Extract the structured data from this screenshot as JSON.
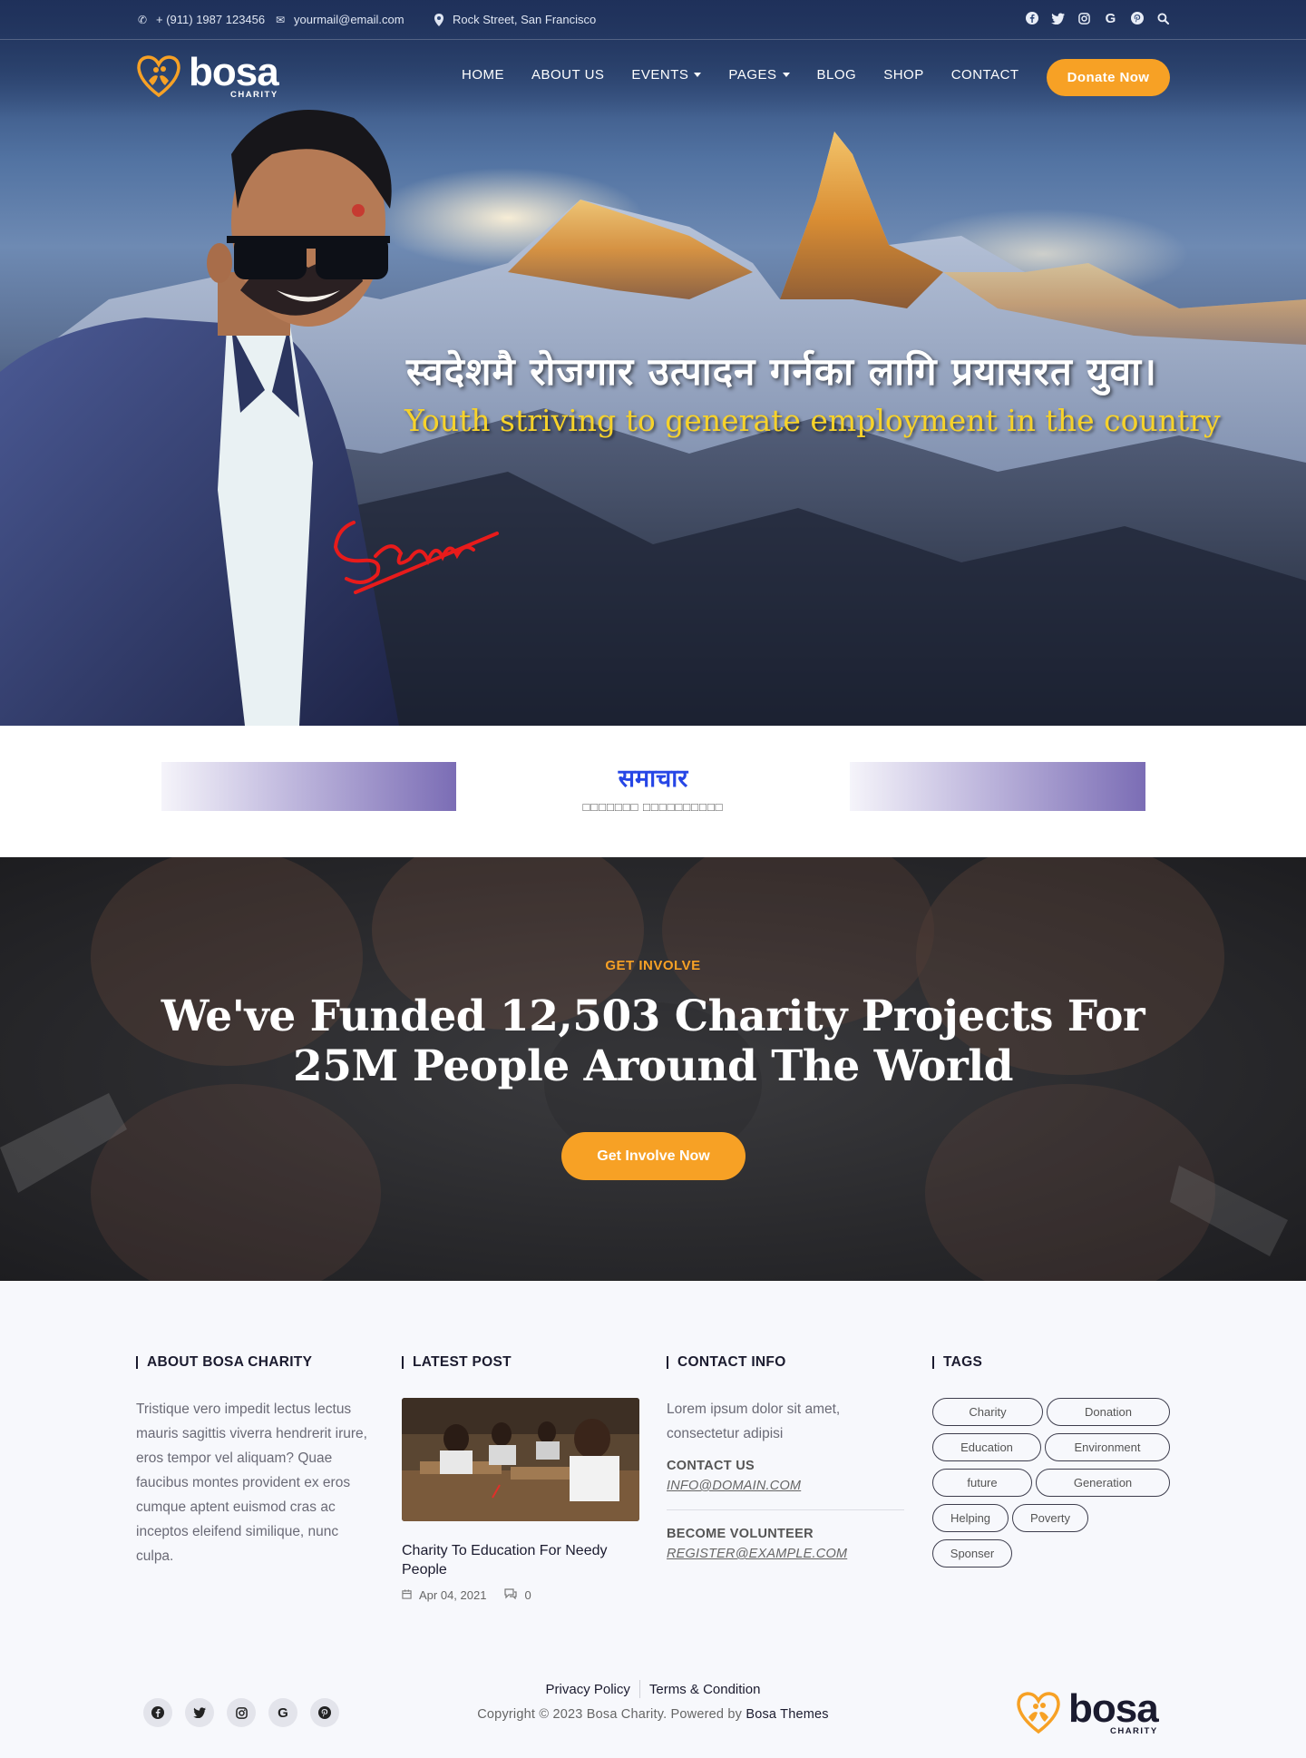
{
  "topbar": {
    "phone": "+ (911) 1987 123456",
    "email": "yourmail@email.com",
    "address": "Rock Street, San Francisco",
    "social_icons": [
      "facebook-icon",
      "twitter-icon",
      "instagram-icon",
      "google-icon",
      "pinterest-icon",
      "search-icon"
    ]
  },
  "brand": {
    "name": "bosa",
    "tagline": "CHARITY"
  },
  "nav": {
    "items": [
      {
        "label": "HOME"
      },
      {
        "label": "ABOUT US"
      },
      {
        "label": "EVENTS"
      },
      {
        "label": "PAGES"
      },
      {
        "label": "BLOG"
      },
      {
        "label": "SHOP"
      },
      {
        "label": "CONTACT"
      }
    ],
    "donate_label": "Donate Now"
  },
  "hero": {
    "nepali_line": "स्वदेशमै रोजगार उत्पादन गर्नका लागि प्रयासरत युवा।",
    "english_line": "Youth striving to generate employment in the country"
  },
  "news": {
    "title": "समाचार",
    "subtitle": "□□□□□□□ □□□□□□□□□□"
  },
  "involve": {
    "kicker": "GET INVOLVE",
    "headline": "We've Funded 12,503 Charity Projects For 25M People Around The World",
    "button_label": "Get Involve Now"
  },
  "footer": {
    "about": {
      "title": "ABOUT BOSA CHARITY",
      "text": "Tristique vero impedit lectus lectus mauris sagittis viverra hendrerit irure, eros tempor vel aliquam? Quae faucibus montes provident ex eros cumque aptent euismod cras ac inceptos eleifend similique, nunc culpa."
    },
    "latest": {
      "title": "LATEST POST",
      "post_title": "Charity To Education For Needy People",
      "date": "Apr 04, 2021",
      "comments": "0"
    },
    "contact": {
      "title": "CONTACT INFO",
      "text": "Lorem ipsum dolor sit amet, consectetur adipisi",
      "contact_heading": "CONTACT US",
      "contact_email": "INFO@DOMAIN.COM",
      "volunteer_heading": "BECOME VOLUNTEER",
      "volunteer_email": "REGISTER@EXAMPLE.COM"
    },
    "tags": {
      "title": "TAGS",
      "items": [
        "Charity",
        "Donation",
        "Education",
        "Environment",
        "future",
        "Generation",
        "Helping",
        "Poverty",
        "Sponser"
      ]
    },
    "legal": {
      "privacy": "Privacy Policy",
      "terms": "Terms & Condition",
      "copyright_prefix": "Copyright © 2023 Bosa Charity. Powered by ",
      "powered_by": "Bosa Themes"
    }
  },
  "colors": {
    "accent": "#f7a125",
    "news_title": "#2646e6",
    "hero_english": "#f6d22b",
    "dark_text": "#1b1b2f"
  }
}
